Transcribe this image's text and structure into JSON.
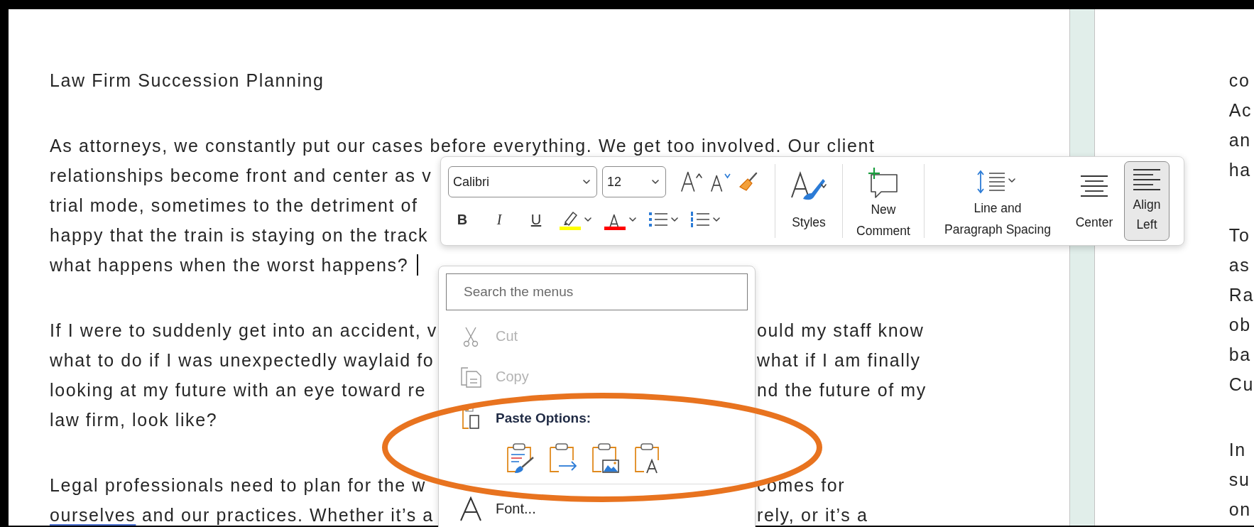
{
  "document": {
    "left_page": {
      "paragraphs": [
        {
          "lines": [
            {
              "text": "Law Firm Succession Planning"
            }
          ]
        },
        {
          "lines": [
            {
              "text": "As attorneys, we constantly put our cases before everything. We get too involved. Our client"
            },
            {
              "text": "relationships become front and center as v"
            },
            {
              "text": "trial mode, sometimes to the detriment of"
            },
            {
              "text": "happy that the train is staying on the track"
            },
            {
              "text": "what happens when the worst happens?",
              "cursor": true
            }
          ]
        },
        {
          "lines": [
            {
              "text": "If I were to suddenly get into an accident, v",
              "after_menu": "ould my staff know"
            },
            {
              "text": "what to do if I was unexpectedly waylaid fo",
              "after_menu": "what if I am finally"
            },
            {
              "text": "looking at my future with an eye toward re",
              "after_menu": "nd the future of my"
            },
            {
              "text": "law firm, look like?"
            }
          ]
        },
        {
          "lines": [
            {
              "text": "Legal professionals need to plan for the w",
              "after_menu": "comes for"
            },
            {
              "flagged_word": "ourselves",
              "text": " and our practices. Whether it’s a",
              "after_menu": "rely, or it’s a"
            }
          ]
        }
      ]
    },
    "right_page": {
      "paragraphs": [
        {
          "lines": [
            "co",
            "Ac",
            "an",
            "ha"
          ]
        },
        {
          "lines": [
            "To",
            "as",
            "Ra",
            "ob",
            "ba",
            "Cu"
          ]
        },
        {
          "lines": [
            "In",
            "su",
            "on"
          ]
        }
      ]
    }
  },
  "mini_toolbar": {
    "font": {
      "value": "Calibri"
    },
    "size": {
      "value": "12"
    },
    "style_buttons": [
      {
        "kind": "bold",
        "label": "B"
      },
      {
        "kind": "italic",
        "label": "I"
      },
      {
        "kind": "underline",
        "label": "U"
      }
    ],
    "color_tools": [
      {
        "kind": "highlight",
        "color": "#ffff00"
      },
      {
        "kind": "font-color",
        "color": "#ff0000"
      }
    ],
    "commands": [
      {
        "kind": "styles",
        "label_lines": [
          "Styles"
        ]
      },
      {
        "kind": "new-comment",
        "label_lines": [
          "New",
          "Comment"
        ]
      },
      {
        "kind": "line-spacing",
        "label_lines": [
          "Line and",
          "Paragraph Spacing"
        ]
      },
      {
        "kind": "center",
        "label_lines": [
          "Center"
        ],
        "selected": false
      },
      {
        "kind": "align-left",
        "label_lines": [
          "Align",
          "Left"
        ],
        "selected": true
      }
    ]
  },
  "context_menu": {
    "search": {
      "placeholder": "Search the menus"
    },
    "items": [
      {
        "kind": "cut",
        "label": "Cut",
        "disabled": true
      },
      {
        "kind": "copy",
        "label": "Copy",
        "disabled": true
      },
      {
        "kind": "header",
        "label": "Paste Options:"
      },
      {
        "kind": "paste-options",
        "options": [
          {
            "kind": "keep-source"
          },
          {
            "kind": "merge"
          },
          {
            "kind": "picture"
          },
          {
            "kind": "text-only"
          }
        ]
      },
      {
        "kind": "font",
        "label": "Font...",
        "disabled": false
      }
    ]
  }
}
